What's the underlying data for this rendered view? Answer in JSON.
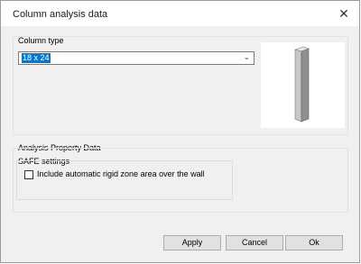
{
  "window": {
    "title": "Column analysis data",
    "close_icon": "close-icon"
  },
  "column_type": {
    "label": "Column type",
    "value": "18 x 24"
  },
  "analysis": {
    "label": "Analysis Property Data"
  },
  "safe": {
    "label": "SAFE settings",
    "checkbox_label": "Include automatic rigid zone area over the wall",
    "checked": false
  },
  "buttons": {
    "apply": "Apply",
    "cancel": "Cancel",
    "ok": "Ok"
  },
  "colors": {
    "selection": "#0078d7",
    "column_light": "#d7d7d7",
    "column_dark": "#8f8f8f"
  }
}
